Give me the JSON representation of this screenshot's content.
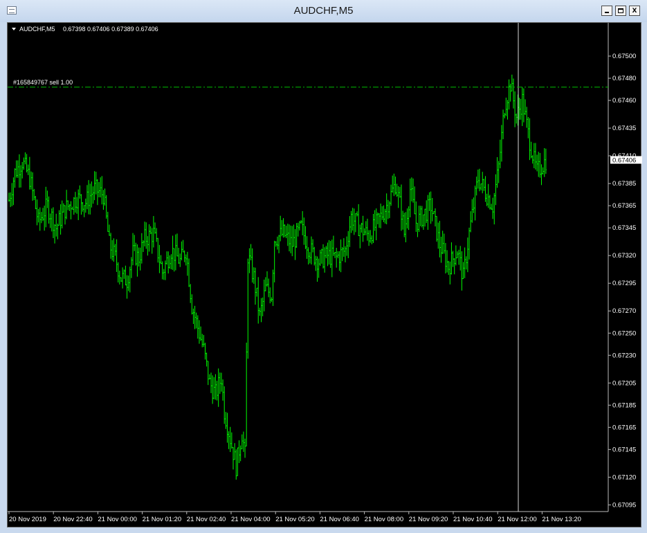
{
  "window": {
    "title": "AUDCHF,M5"
  },
  "chart_header": {
    "symbol": "AUDCHF,M5",
    "ohlc": "0.67398 0.67406 0.67389 0.67406"
  },
  "order_line": {
    "label": "#165849767 sell 1.00",
    "price": 0.67472
  },
  "current_price_label": "0.67406",
  "chart_data": {
    "type": "candlestick",
    "symbol": "AUDCHF",
    "timeframe": "M5",
    "x_tick_labels": [
      "20 Nov 2019",
      "20 Nov 22:40",
      "21 Nov 00:00",
      "21 Nov 01:20",
      "21 Nov 02:40",
      "21 Nov 04:00",
      "21 Nov 05:20",
      "21 Nov 06:40",
      "21 Nov 08:00",
      "21 Nov 09:20",
      "21 Nov 10:40",
      "21 Nov 12:00",
      "21 Nov 13:20"
    ],
    "y_tick_labels": [
      "0.67500",
      "0.67480",
      "0.67460",
      "0.67435",
      "0.67410",
      "0.67385",
      "0.67365",
      "0.67345",
      "0.67320",
      "0.67295",
      "0.67270",
      "0.67250",
      "0.67230",
      "0.67205",
      "0.67185",
      "0.67165",
      "0.67145",
      "0.67120",
      "0.67095"
    ],
    "ylim": [
      0.67089,
      0.6753
    ],
    "current_price": 0.67406,
    "grid": false,
    "colors": {
      "background": "#000000",
      "bars": "#00ff00",
      "order_line": "#00c000",
      "axis_text": "#ffffff"
    },
    "close_path": [
      [
        0,
        0.6737
      ],
      [
        4,
        0.67395
      ],
      [
        9,
        0.67405
      ],
      [
        14,
        0.6739
      ],
      [
        20,
        0.6735
      ],
      [
        26,
        0.67365
      ],
      [
        32,
        0.67345
      ],
      [
        38,
        0.67362
      ],
      [
        46,
        0.67372
      ],
      [
        52,
        0.67368
      ],
      [
        58,
        0.6738
      ],
      [
        64,
        0.67375
      ],
      [
        68,
        0.6733
      ],
      [
        72,
        0.67318
      ],
      [
        76,
        0.673
      ],
      [
        80,
        0.67298
      ],
      [
        84,
        0.67322
      ],
      [
        88,
        0.67318
      ],
      [
        92,
        0.67335
      ],
      [
        98,
        0.6734
      ],
      [
        104,
        0.67305
      ],
      [
        110,
        0.67325
      ],
      [
        116,
        0.67315
      ],
      [
        120,
        0.67325
      ],
      [
        124,
        0.67275
      ],
      [
        128,
        0.67255
      ],
      [
        132,
        0.67235
      ],
      [
        136,
        0.67205
      ],
      [
        140,
        0.67195
      ],
      [
        144,
        0.6721
      ],
      [
        146,
        0.6718
      ],
      [
        150,
        0.67155
      ],
      [
        154,
        0.6713
      ],
      [
        158,
        0.6716
      ],
      [
        160,
        0.6714
      ],
      [
        162,
        0.6732
      ],
      [
        166,
        0.673
      ],
      [
        170,
        0.67265
      ],
      [
        174,
        0.6729
      ],
      [
        178,
        0.67285
      ],
      [
        180,
        0.67335
      ],
      [
        186,
        0.6734
      ],
      [
        192,
        0.6733
      ],
      [
        198,
        0.67345
      ],
      [
        204,
        0.67325
      ],
      [
        210,
        0.67315
      ],
      [
        216,
        0.6732
      ],
      [
        222,
        0.67318
      ],
      [
        228,
        0.67325
      ],
      [
        232,
        0.67355
      ],
      [
        238,
        0.67345
      ],
      [
        244,
        0.67338
      ],
      [
        250,
        0.6735
      ],
      [
        256,
        0.67365
      ],
      [
        262,
        0.67385
      ],
      [
        266,
        0.6736
      ],
      [
        268,
        0.6734
      ],
      [
        272,
        0.6738
      ],
      [
        276,
        0.6735
      ],
      [
        280,
        0.67355
      ],
      [
        286,
        0.67365
      ],
      [
        292,
        0.6733
      ],
      [
        298,
        0.6731
      ],
      [
        304,
        0.67325
      ],
      [
        308,
        0.673
      ],
      [
        312,
        0.6734
      ],
      [
        318,
        0.6739
      ],
      [
        324,
        0.67375
      ],
      [
        328,
        0.67365
      ],
      [
        332,
        0.674
      ],
      [
        336,
        0.67455
      ],
      [
        340,
        0.67475
      ],
      [
        344,
        0.67445
      ],
      [
        348,
        0.6746
      ],
      [
        352,
        0.6743
      ],
      [
        356,
        0.67405
      ],
      [
        358,
        0.67395
      ],
      [
        362,
        0.67403
      ],
      [
        364,
        0.67406
      ]
    ]
  }
}
